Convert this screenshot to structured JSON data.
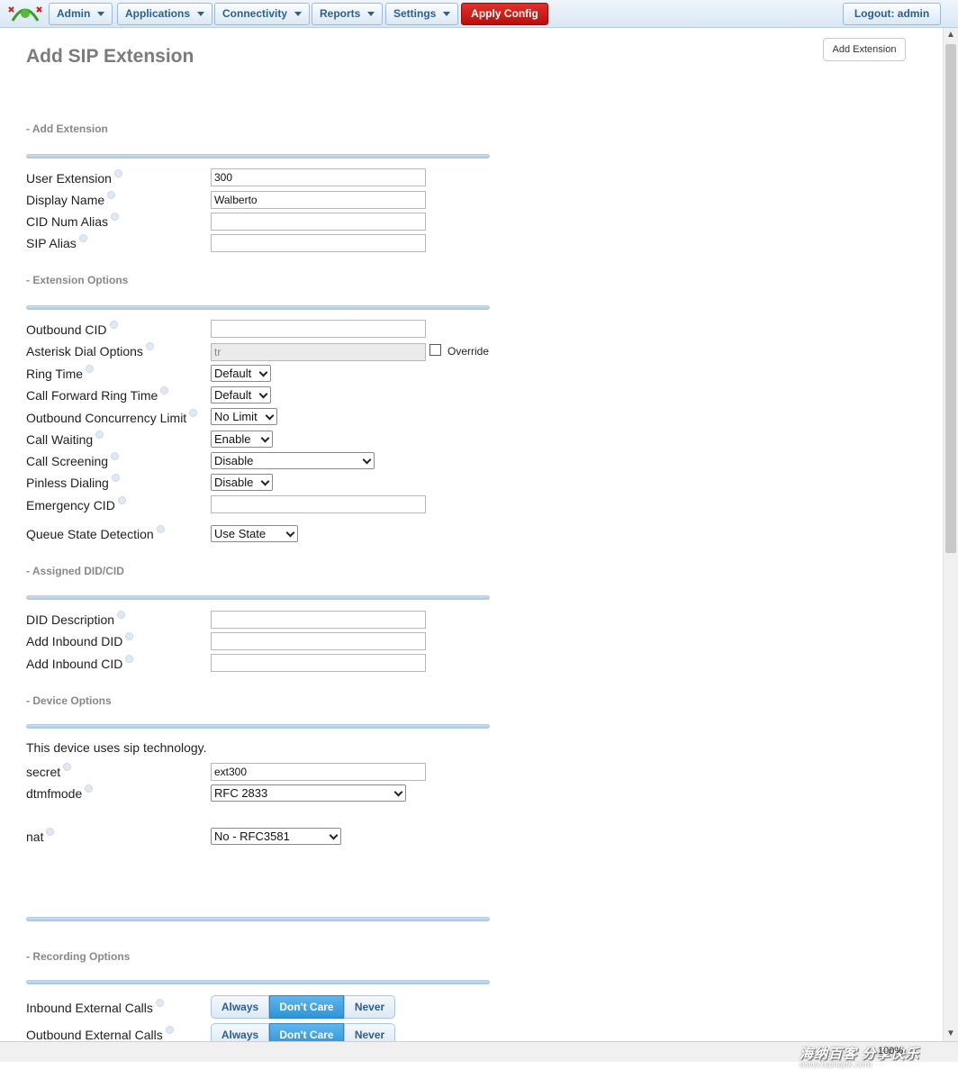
{
  "nav": {
    "items": [
      "Admin",
      "Applications",
      "Connectivity",
      "Reports",
      "Settings"
    ],
    "apply": "Apply Config",
    "logout": "Logout: admin"
  },
  "page": {
    "title": "Add SIP Extension",
    "add_button": "Add Extension"
  },
  "sections": {
    "add_extension": "- Add Extension",
    "extension_options": "- Extension Options",
    "assigned": "- Assigned DID/CID",
    "device": "- Device Options",
    "recording": "- Recording Options"
  },
  "fields": {
    "user_extension": {
      "label": "User Extension",
      "value": "300"
    },
    "display_name": {
      "label": "Display Name",
      "value": "Walberto"
    },
    "cid_num_alias": {
      "label": "CID Num Alias",
      "value": ""
    },
    "sip_alias": {
      "label": "SIP Alias",
      "value": ""
    },
    "outbound_cid": {
      "label": "Outbound CID",
      "value": ""
    },
    "dial_options": {
      "label": "Asterisk Dial Options",
      "value": "tr",
      "override": "Override"
    },
    "ring_time": {
      "label": "Ring Time",
      "value": "Default"
    },
    "cf_ring_time": {
      "label": "Call Forward Ring Time",
      "value": "Default"
    },
    "concurrency": {
      "label": "Outbound Concurrency Limit",
      "value": "No Limit"
    },
    "call_waiting": {
      "label": "Call Waiting",
      "value": "Enable"
    },
    "call_screening": {
      "label": "Call Screening",
      "value": "Disable"
    },
    "pinless": {
      "label": "Pinless Dialing",
      "value": "Disable"
    },
    "emergency_cid": {
      "label": "Emergency CID",
      "value": ""
    },
    "queue_state": {
      "label": "Queue State Detection",
      "value": "Use State"
    },
    "did_desc": {
      "label": "DID Description",
      "value": ""
    },
    "inbound_did": {
      "label": "Add Inbound DID",
      "value": ""
    },
    "inbound_cid": {
      "label": "Add Inbound CID",
      "value": ""
    },
    "device_text": "This device uses sip technology.",
    "secret": {
      "label": "secret",
      "value": "ext300"
    },
    "dtmfmode": {
      "label": "dtmfmode",
      "value": "RFC 2833"
    },
    "nat": {
      "label": "nat",
      "value": "No - RFC3581"
    }
  },
  "recording": {
    "inbound_external": "Inbound External Calls",
    "outbound_external": "Outbound External Calls",
    "options": [
      "Always",
      "Don't Care",
      "Never"
    ]
  },
  "status": {
    "zoom": "100%",
    "watermark": "海纳百客 分享快乐",
    "watermark_url": "www.hainabk.com"
  }
}
